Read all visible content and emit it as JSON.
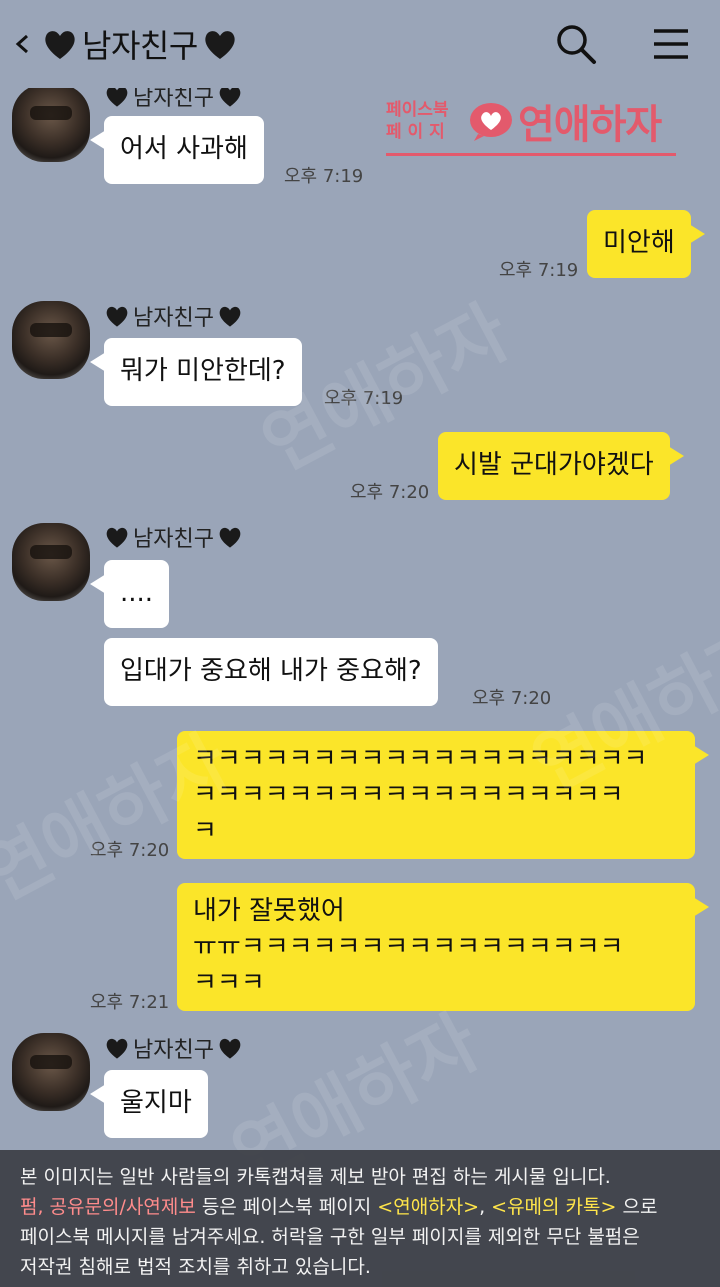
{
  "header": {
    "title": "남자친구",
    "back_icon": "chevron-left-icon",
    "heart_icon": "black-heart-icon",
    "search_icon": "search-icon",
    "menu_icon": "hamburger-menu-icon"
  },
  "watermark": {
    "small_text_1": "페이스북",
    "small_text_2": "페 이 지",
    "big_text": "연애하자",
    "color": "#e35a6c"
  },
  "colors": {
    "background": "#9aa5b8",
    "incoming_bubble": "#ffffff",
    "outgoing_bubble": "#fbe529"
  },
  "messages": [
    {
      "direction": "in",
      "sender": "남자친구",
      "text": "어서 사과해",
      "time": "오후 7:19"
    },
    {
      "direction": "out",
      "text": "미안해",
      "time": "오후 7:19"
    },
    {
      "direction": "in",
      "sender": "남자친구",
      "text": "뭐가 미안한데?",
      "time": "오후 7:19"
    },
    {
      "direction": "out",
      "text": "시발 군대가야겠다",
      "time": "오후 7:20"
    },
    {
      "direction": "in",
      "sender": "남자친구",
      "text": "....",
      "time": ""
    },
    {
      "direction": "in",
      "text": "입대가 중요해 내가 중요해?",
      "time": "오후 7:20"
    },
    {
      "direction": "out",
      "lines": [
        "ㅋㅋㅋㅋㅋㅋㅋㅋㅋㅋㅋㅋㅋㅋㅋㅋㅋㅋㅋ",
        "ㅋㅋㅋㅋㅋㅋㅋㅋㅋㅋㅋㅋㅋㅋㅋㅋㅋㅋ",
        "ㅋ"
      ],
      "time": "오후 7:20"
    },
    {
      "direction": "out",
      "lines": [
        "내가 잘못했어",
        "ㅠㅠㅋㅋㅋㅋㅋㅋㅋㅋㅋㅋㅋㅋㅋㅋㅋㅋ",
        "ㅋㅋㅋ"
      ],
      "time": "오후 7:21"
    },
    {
      "direction": "in",
      "sender": "남자친구",
      "text": "울지마",
      "time": ""
    }
  ],
  "footer": {
    "line1": "본 이미지는 일반 사람들의 카톡캡쳐를 제보 받아 편집 하는 게시물 입니다.",
    "line2_red": "펌, 공유문의/사연제보",
    "line2_mid": " 등은 페이스북 페이지 ",
    "line2_yellow1": "<연애하자>",
    "line2_comma": ", ",
    "line2_yellow2": "<유메의 카톡>",
    "line2_end": " 으로",
    "line3": "페이스북 메시지를 남겨주세요. 허락을 구한 일부 페이지를 제외한 무단 불펌은",
    "line4": "저작권 침해로 법적 조치를 취하고 있습니다."
  }
}
